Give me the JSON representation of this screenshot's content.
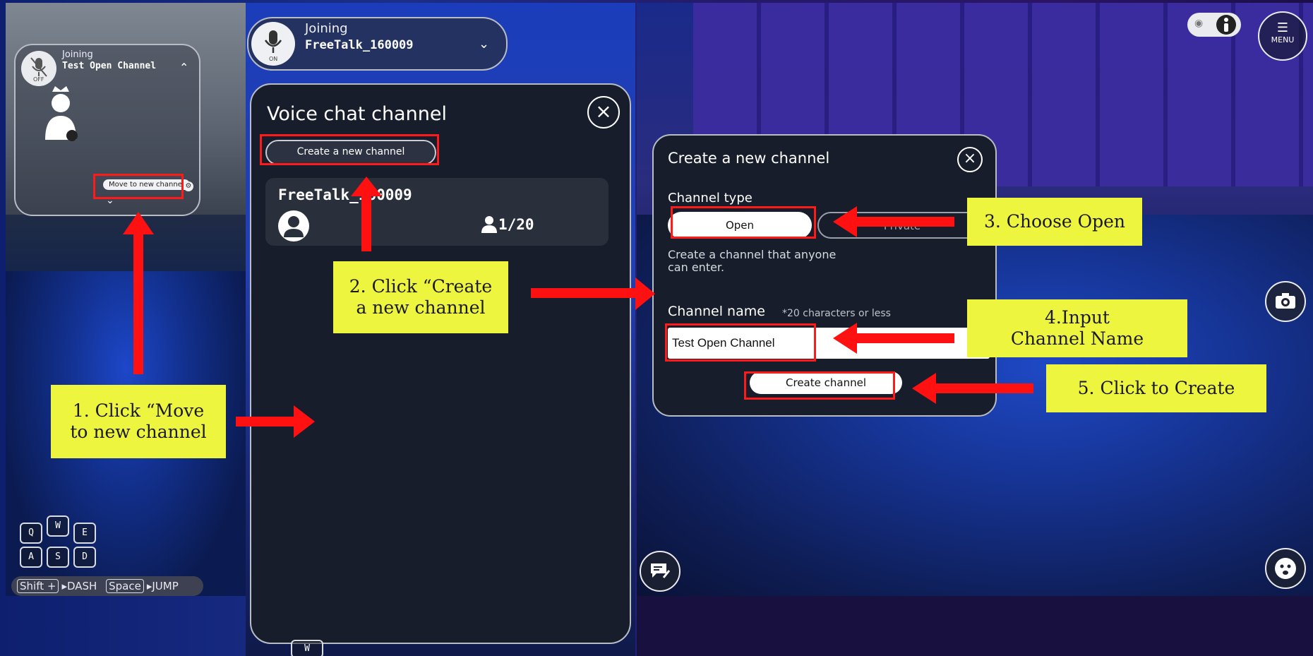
{
  "panel1": {
    "mini_card": {
      "joining_label": "Joining",
      "channel_name": "Test Open Channel",
      "mic_state": "OFF",
      "move_button_label": "Move to new channel"
    },
    "keys": [
      "Q",
      "W",
      "E",
      "A",
      "S",
      "D"
    ],
    "hint": {
      "shift": "Shift +",
      "dash": "DASH",
      "space": "Space",
      "jump": "JUMP"
    }
  },
  "panel2": {
    "status_pill": {
      "joining_label": "Joining",
      "channel_name": "FreeTalk_160009",
      "mic_state": "ON"
    },
    "dialog": {
      "title": "Voice chat channel",
      "create_button_label": "Create a new channel",
      "channels": [
        {
          "name": "FreeTalk_160009",
          "count": "1/20"
        }
      ]
    },
    "bottom_keys": [
      "W"
    ]
  },
  "panel3": {
    "menu_label": "MENU",
    "dialog": {
      "title": "Create a new channel",
      "channel_type_label": "Channel type",
      "open_label": "Open",
      "private_label": "Private",
      "description": "Create a channel that anyone can enter.",
      "channel_name_label": "Channel name",
      "channel_name_note": "*20 characters or less",
      "channel_name_value": "Test Open Channel",
      "create_button_label": "Create channel"
    }
  },
  "callouts": {
    "step1": "1. Click “Move to new channel",
    "step2": "2. Click “Create a new channel",
    "step3": "3. Choose Open",
    "step4": "4.Input Channel Name",
    "step5": "5. Click to Create"
  },
  "colors": {
    "callout_bg": "#eef53e",
    "highlight": "#ff1a1a",
    "dialog_bg": "#171d2a"
  }
}
